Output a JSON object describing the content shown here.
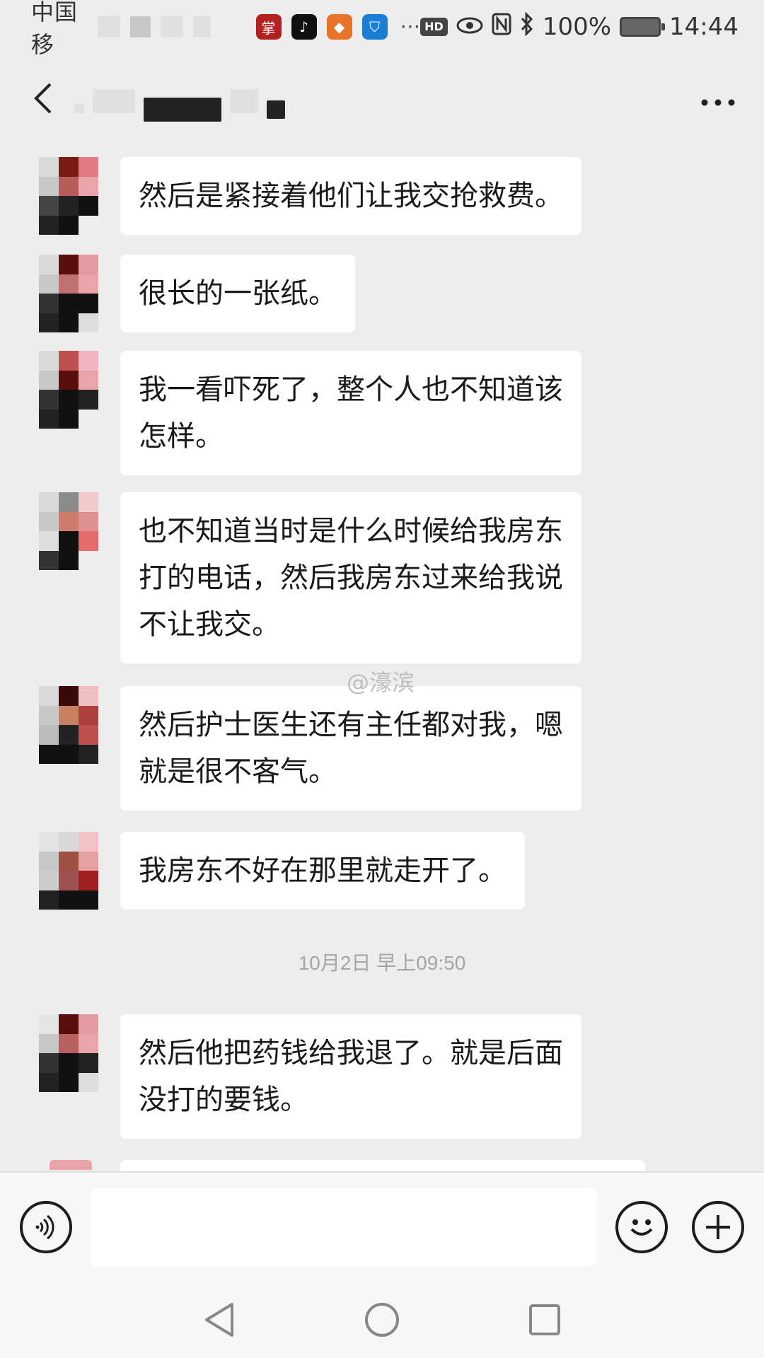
{
  "status_bar": {
    "carrier": "中国移",
    "battery": "100%",
    "time": "14:44",
    "hd_label": "HD",
    "more_apps": "···",
    "app_icons": [
      "zhangyue-icon",
      "tiktok-icon",
      "fox-app-icon",
      "shield-app-icon"
    ]
  },
  "header": {
    "back_icon": "chevron-left-icon",
    "more_icon": "more-dots-icon"
  },
  "messages": [
    {
      "text": "然后是紧接着他们让我交抢救费。"
    },
    {
      "text": "很长的一张纸。"
    },
    {
      "text": "我一看吓死了，整个人也不知道该\n怎样。"
    },
    {
      "text": "也不知道当时是什么时候给我房东\n打的电话，然后我房东过来给我说\n不让我交。"
    },
    {
      "text": "然后护士医生还有主任都对我，嗯\n就是很不客气。"
    },
    {
      "text": "我房东不好在那里就走开了。"
    },
    {
      "text": "然后他把药钱给我退了。就是后面\n没打的要钱。"
    }
  ],
  "timestamp": "10月2日 早上09:50",
  "watermark": "@濠滨",
  "input_bar": {
    "placeholder": "",
    "voice_icon": "voice-icon",
    "emoji_icon": "emoji-icon",
    "plus_icon": "plus-icon"
  },
  "nav_bar": {
    "back": "nav-back-icon",
    "home": "nav-home-icon",
    "recent": "nav-recent-icon"
  },
  "colors": {
    "background": "#ededed",
    "bubble": "#ffffff",
    "timestamp": "#a5a5a5"
  }
}
